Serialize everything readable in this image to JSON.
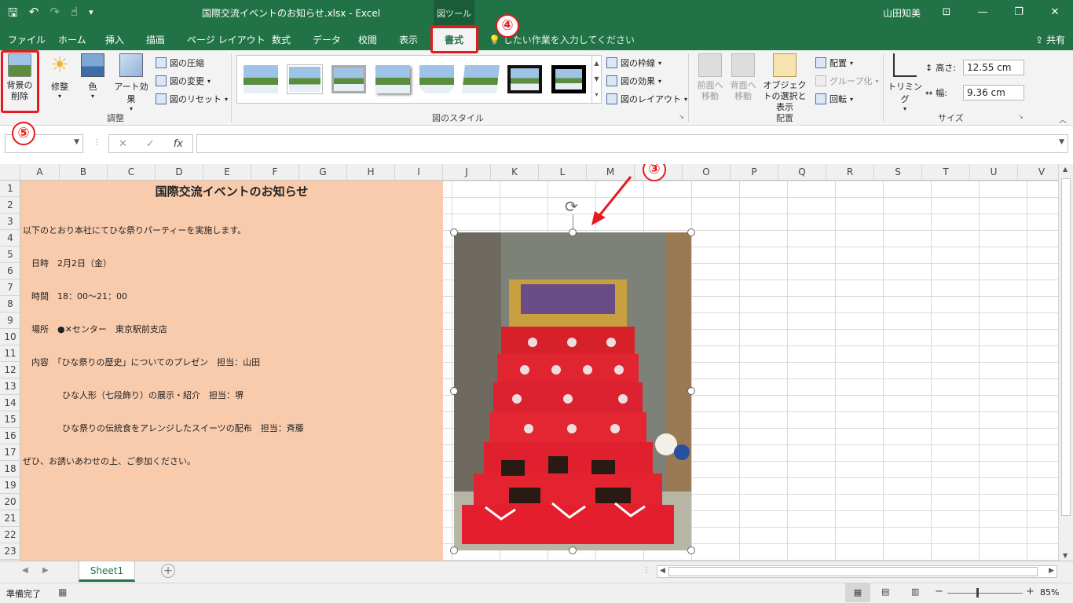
{
  "window": {
    "title": "国際交流イベントのお知らせ.xlsx  -  Excel",
    "context_tab_group": "図ツール",
    "user": "山田知美"
  },
  "tabs": [
    {
      "label": "ファイル"
    },
    {
      "label": "ホーム"
    },
    {
      "label": "挿入"
    },
    {
      "label": "描画"
    },
    {
      "label": "ページ レイアウト"
    },
    {
      "label": "数式"
    },
    {
      "label": "データ"
    },
    {
      "label": "校閲"
    },
    {
      "label": "表示"
    },
    {
      "label": "書式"
    }
  ],
  "tell_me": "したい作業を入力してください",
  "share": "共有",
  "annotations": {
    "badge4": "④",
    "badge5": "⑤",
    "badge3": "③"
  },
  "ribbon": {
    "adjust": {
      "remove_bg": "背景の削除",
      "corrections": "修整",
      "color": "色",
      "art_effects": "アート効果",
      "compress": "図の圧縮",
      "change": "図の変更",
      "reset": "図のリセット",
      "label": "調整"
    },
    "styles": {
      "border": "図の枠線",
      "effects": "図の効果",
      "layout": "図のレイアウト",
      "label": "図のスタイル"
    },
    "arrange": {
      "bring_forward": "前面へ移動",
      "send_backward": "背面へ移動",
      "selection_pane": "オブジェクトの選択と表示",
      "align": "配置",
      "group": "グループ化",
      "rotate": "回転",
      "label": "配置"
    },
    "size": {
      "crop": "トリミング",
      "height_label": "高さ:",
      "height_value": "12.55 cm",
      "width_label": "幅:",
      "width_value": "9.36 cm",
      "label": "サイズ"
    }
  },
  "formula_bar": {
    "fx": "fx",
    "cancel": "✕",
    "enter": "✓"
  },
  "columns": [
    "A",
    "B",
    "C",
    "D",
    "E",
    "F",
    "G",
    "H",
    "I",
    "J",
    "K",
    "L",
    "M",
    "N",
    "O",
    "P",
    "Q",
    "R",
    "S",
    "T",
    "U",
    "V"
  ],
  "rows": [
    "1",
    "2",
    "3",
    "4",
    "5",
    "6",
    "7",
    "8",
    "9",
    "10",
    "11",
    "12",
    "13",
    "14",
    "15",
    "16",
    "17",
    "18",
    "19",
    "20",
    "21",
    "22",
    "23"
  ],
  "sheet_content": {
    "title": "国際交流イベントのお知らせ",
    "line3": "以下のとおり本社にてひな祭りパーティーを実施します。",
    "line5": "日時　2月2日（金）",
    "line7": "時間　18：00〜21：00",
    "line9": "場所　●✕センター　東京駅前支店",
    "line11": "内容　「ひな祭りの歴史」についてのプレゼン　担当：山田",
    "line13": "ひな人形（七段飾り）の展示・紹介　担当：堺",
    "line15": "ひな祭りの伝統食をアレンジしたスイーツの配布　担当：斉藤",
    "line17": "ぜひ、お誘いあわせの上、ご参加ください。"
  },
  "sheet_tabs": [
    "Sheet1"
  ],
  "status": {
    "ready": "準備完了",
    "zoom": "85%"
  },
  "colors": {
    "excel_green": "#217346",
    "highlight_red": "#e8191f",
    "cell_fill": "#f8cbad"
  }
}
